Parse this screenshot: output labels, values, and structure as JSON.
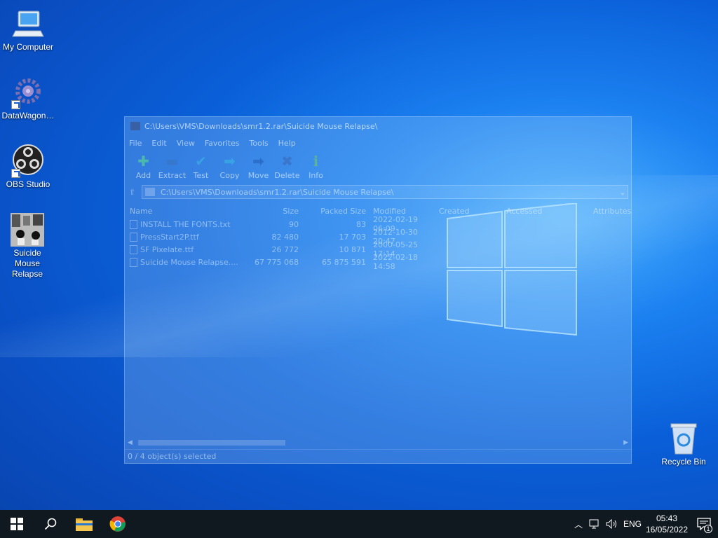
{
  "desktop": {
    "icons": [
      {
        "label": "My Computer"
      },
      {
        "label": "DataWagon…"
      },
      {
        "label": "OBS Studio"
      },
      {
        "label": "Suicide Mouse Relapse"
      },
      {
        "label": "Recycle Bin"
      }
    ]
  },
  "window": {
    "title": "C:\\Users\\VMS\\Downloads\\smr1.2.rar\\Suicide Mouse Relapse\\",
    "menu": [
      "File",
      "Edit",
      "View",
      "Favorites",
      "Tools",
      "Help"
    ],
    "toolbar": [
      "Add",
      "Extract",
      "Test",
      "Copy",
      "Move",
      "Delete",
      "Info"
    ],
    "address": "C:\\Users\\VMS\\Downloads\\smr1.2.rar\\Suicide Mouse Relapse\\",
    "columns": [
      "Name",
      "Size",
      "Packed Size",
      "Modified",
      "Created",
      "Accessed",
      "Attributes"
    ],
    "files": [
      {
        "name": "INSTALL THE FONTS.txt",
        "size": "90",
        "packed": "83",
        "modified": "2022-02-19 06:09"
      },
      {
        "name": "PressStart2P.ttf",
        "size": "82 480",
        "packed": "17 703",
        "modified": "2012-10-30 20:47"
      },
      {
        "name": "SF Pixelate.ttf",
        "size": "26 772",
        "packed": "10 871",
        "modified": "2000-05-25 17:14"
      },
      {
        "name": "Suicide Mouse Relapse....",
        "size": "67 775 068",
        "packed": "65 875 591",
        "modified": "2022-02-18 14:58"
      }
    ],
    "status": "0 / 4 object(s) selected"
  },
  "taskbar": {
    "lang": "ENG",
    "time": "05:43",
    "date": "16/05/2022",
    "notifications": "1"
  }
}
